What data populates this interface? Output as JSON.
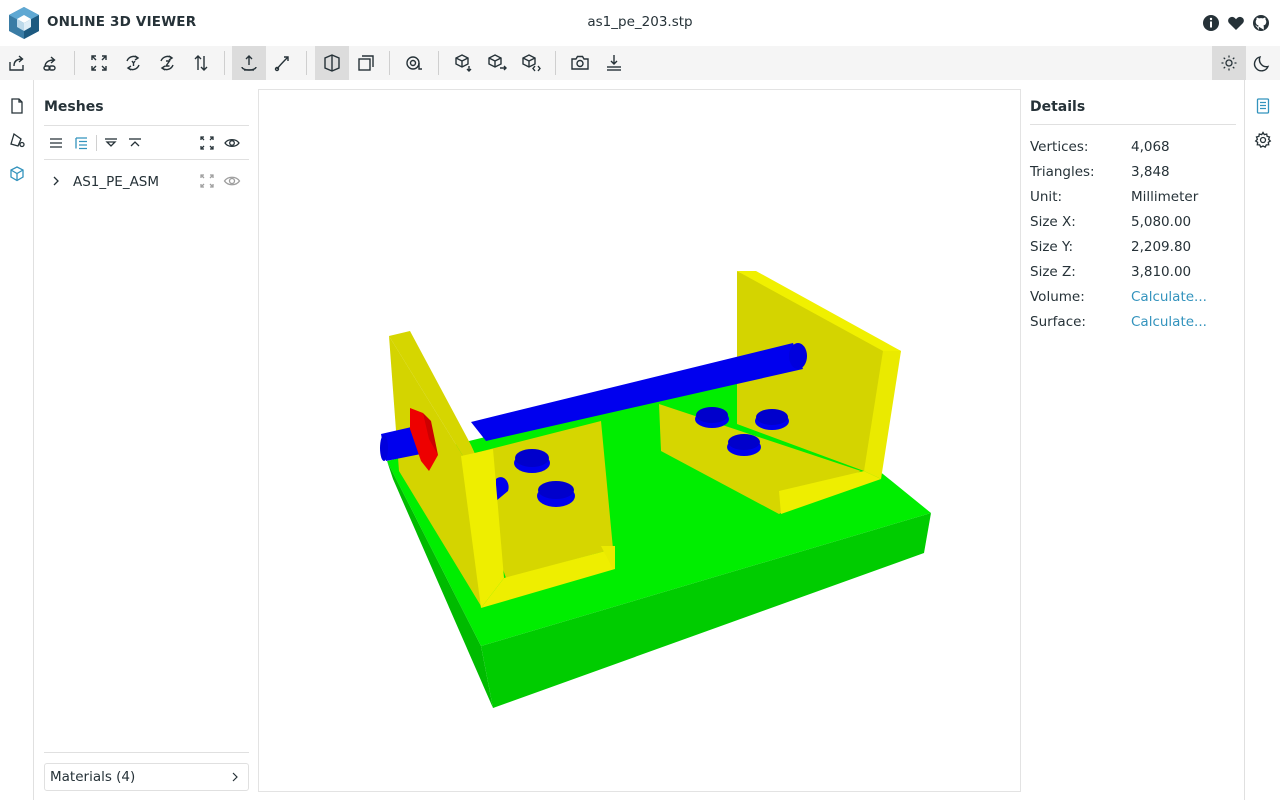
{
  "header": {
    "app_title": "ONLINE 3D VIEWER",
    "file_title": "as1_pe_203.stp",
    "icons": [
      "info-icon",
      "heart-icon",
      "github-icon"
    ]
  },
  "toolbar": {
    "buttons": [
      "open-file",
      "open-url",
      "fit-to-window",
      "set-up-y",
      "set-up-z",
      "flip-up",
      "fixed-up",
      "free-orbit",
      "perspective",
      "orthographic",
      "measure",
      "export-model",
      "share-model",
      "embed-model",
      "snapshot",
      "cross-section"
    ],
    "selected": [
      "fixed-up",
      "perspective"
    ],
    "right_buttons": [
      "light-mode",
      "dark-mode"
    ]
  },
  "meshes_panel": {
    "title": "Meshes",
    "tree": [
      {
        "label": "AS1_PE_ASM",
        "expanded": false
      }
    ],
    "materials_label": "Materials (4)"
  },
  "details_panel": {
    "title": "Details",
    "rows": [
      {
        "key": "Vertices:",
        "value": "4,068",
        "link": false
      },
      {
        "key": "Triangles:",
        "value": "3,848",
        "link": false
      },
      {
        "key": "Unit:",
        "value": "Millimeter",
        "link": false
      },
      {
        "key": "Size X:",
        "value": "5,080.00",
        "link": false
      },
      {
        "key": "Size Y:",
        "value": "2,209.80",
        "link": false
      },
      {
        "key": "Size Z:",
        "value": "3,810.00",
        "link": false
      },
      {
        "key": "Volume:",
        "value": "Calculate...",
        "link": true
      },
      {
        "key": "Surface:",
        "value": "Calculate...",
        "link": true
      }
    ]
  },
  "colors": {
    "accent": "#3393bd",
    "plate": "#00ee00",
    "bracket": "#eeee00",
    "rod": "#0000ee",
    "block": "#ee0000"
  }
}
